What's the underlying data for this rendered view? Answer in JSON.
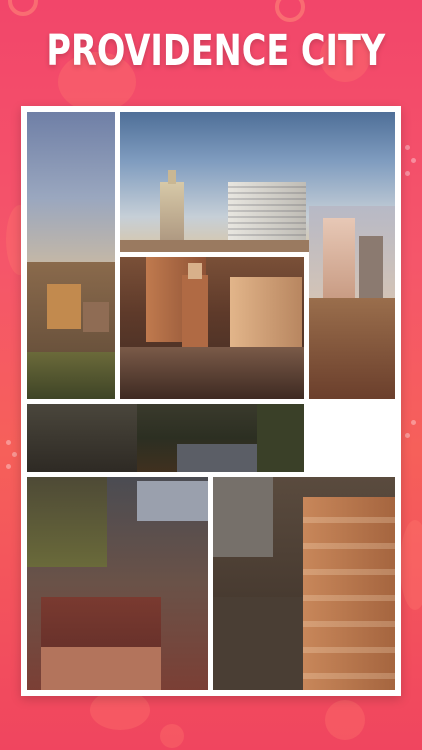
{
  "title": "PROVIDENCE CITY",
  "colors": {
    "background_top": "#f2466a",
    "background_bottom": "#f0455f",
    "frame": "#ffffff",
    "title_text": "#ffffff"
  },
  "collage": {
    "tile_count": 7,
    "tiles": [
      "photo-skyline-left",
      "photo-skyline-towers",
      "photo-skyline-right",
      "photo-downtown-center",
      "photo-treetops",
      "photo-rooftops",
      "photo-brick-buildings"
    ]
  }
}
